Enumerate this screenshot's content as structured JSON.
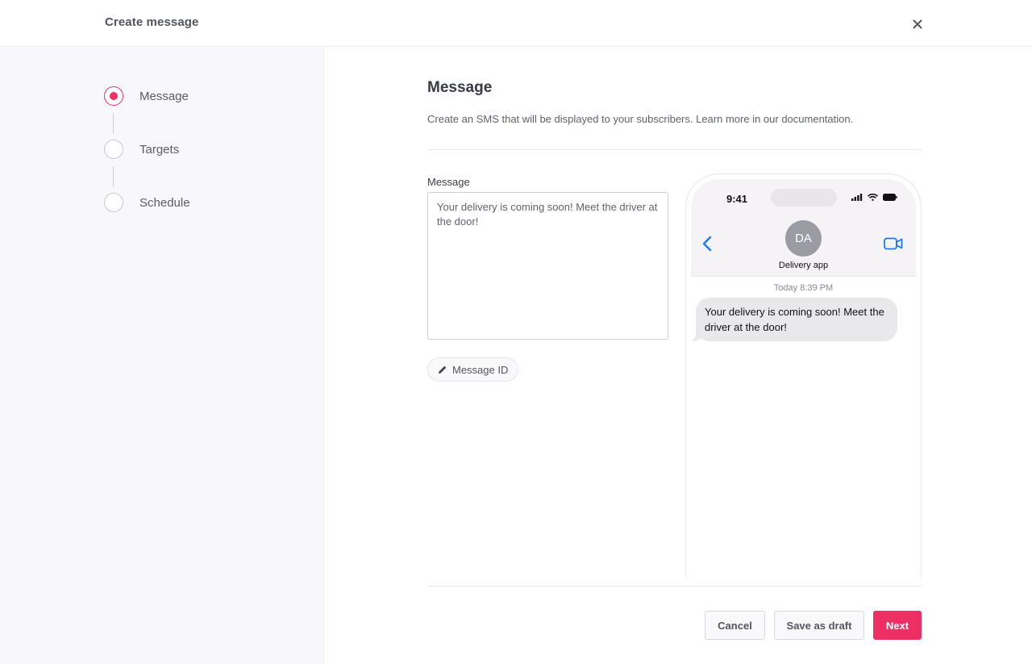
{
  "header": {
    "title": "Create message"
  },
  "steps": [
    {
      "label": "Message",
      "state": "active"
    },
    {
      "label": "Targets",
      "state": "pending"
    },
    {
      "label": "Schedule",
      "state": "pending"
    }
  ],
  "main": {
    "heading": "Message",
    "description": "Create an SMS that will be displayed to your subscribers. Learn more in our documentation.",
    "field_label": "Message",
    "message_value": "Your delivery is coming soon! Meet the driver at the door!",
    "message_id_label": "Message ID"
  },
  "preview": {
    "time": "9:41",
    "avatar_initials": "DA",
    "contact_name": "Delivery app",
    "timestamp": "Today 8:39 PM",
    "bubble_text": "Your delivery is coming soon! Meet the driver at the door!"
  },
  "footer": {
    "cancel_label": "Cancel",
    "draft_label": "Save as draft",
    "next_label": "Next"
  },
  "colors": {
    "accent": "#ee2f63",
    "ios_blue": "#1a7cf1",
    "sidebar_bg": "#f8f7fb"
  },
  "icons": [
    "close-icon",
    "pencil-icon",
    "chevron-left-icon",
    "video-camera-icon",
    "signal-icon",
    "wifi-icon",
    "battery-icon"
  ]
}
